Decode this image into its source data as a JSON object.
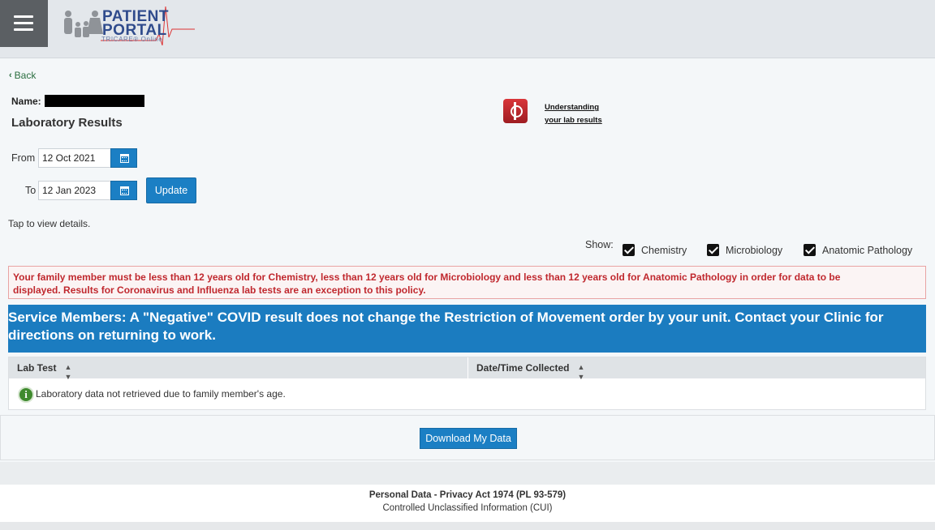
{
  "header": {
    "menu_icon": "hamburger-icon",
    "logo": {
      "line1": "PATIENT",
      "line2": "PORTAL",
      "sub": "TRICARE® Online"
    }
  },
  "nav": {
    "back_label": "Back"
  },
  "patient": {
    "name_label": "Name:"
  },
  "page": {
    "title": "Laboratory Results",
    "help_link_line1": "Understanding",
    "help_link_line2": "your lab results"
  },
  "date_range": {
    "from_label": "From",
    "from_value": "12 Oct 2021",
    "to_label": "To",
    "to_value": "12 Jan 2023",
    "update_label": "Update"
  },
  "instructions": "Tap to view details.",
  "filters": {
    "show_label": "Show:",
    "items": [
      {
        "label": "Chemistry",
        "checked": true
      },
      {
        "label": "Microbiology",
        "checked": true
      },
      {
        "label": "Anatomic Pathology",
        "checked": true
      }
    ]
  },
  "alert": {
    "line1": "Your family member must be less than 12 years old for Chemistry, less than 12 years old for Microbiology and less than 12 years old for Anatomic Pathology in order for data to be",
    "line2": "displayed.  Results for Coronavirus and Influenza lab tests are an exception to this policy."
  },
  "banner": {
    "line1": "Service Members: A \"Negative\" COVID result does not change the Restriction of Movement order by your unit. Contact your Clinic for",
    "line2": "directions on returning to work."
  },
  "table": {
    "columns": [
      "Lab Test",
      "Date/Time Collected"
    ],
    "empty_message": "Laboratory data not retrieved due to family member's age."
  },
  "download_label": "Download My Data",
  "footer": {
    "line1": "Personal Data - Privacy Act 1974 (PL 93-579)",
    "line2": "Controlled Unclassified Information (CUI)"
  },
  "colors": {
    "primary": "#1b7fc4",
    "alert_text": "#c0282e",
    "banner_bg": "#1b7cc0",
    "back_link": "#2a6e3f"
  }
}
